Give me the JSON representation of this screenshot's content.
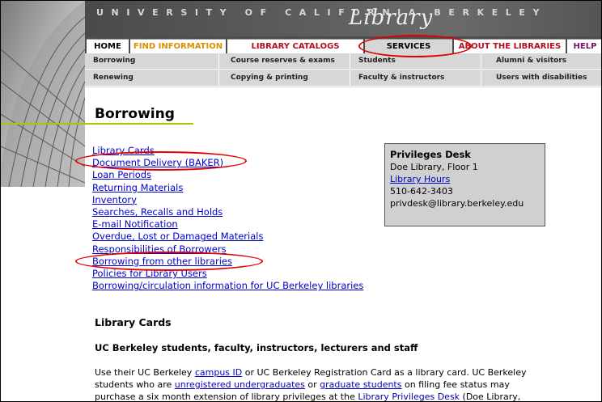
{
  "banner": {
    "university": "UNIVERSITY OF CALIFORNIA BERKELEY",
    "library": "Library"
  },
  "tabs": [
    {
      "label": "HOME",
      "name": "tab-home"
    },
    {
      "label": "FIND INFORMATION",
      "name": "tab-find-information"
    },
    {
      "label": "LIBRARY CATALOGS",
      "name": "tab-library-catalogs"
    },
    {
      "label": "SERVICES",
      "name": "tab-services"
    },
    {
      "label": "ABOUT THE LIBRARIES",
      "name": "tab-about-the-libraries"
    },
    {
      "label": "HELP",
      "name": "tab-help"
    }
  ],
  "subnav": {
    "row1": [
      "Borrowing",
      "Course reserves & exams",
      "Students",
      "Alumni & visitors"
    ],
    "row2": [
      "Renewing",
      "Copying & printing",
      "Faculty & instructors",
      "Users with disabilities"
    ]
  },
  "page": {
    "title": "Borrowing"
  },
  "links": [
    "Library Cards",
    "Document Delivery (BAKER)",
    "Loan Periods",
    "Returning Materials",
    "Inventory",
    "Searches, Recalls and Holds",
    "E-mail Notification",
    "Overdue, Lost or Damaged Materials",
    "Responsibilities of Borrowers",
    "Borrowing from other libraries",
    "Policies for Library Users",
    "Borrowing/circulation information for UC Berkeley libraries"
  ],
  "desk": {
    "title": "Privileges Desk",
    "location": "Doe Library, Floor 1",
    "hours_link": "Library Hours",
    "phone": "510-642-3403",
    "email": "privdesk@library.berkeley.edu"
  },
  "section": {
    "heading": "Library Cards",
    "subheading": "UC Berkeley students, faculty, instructors, lecturers and staff",
    "p1": "Use their UC Berkeley ",
    "link_campus_id": "campus ID",
    "p2": " or UC Berkeley Registration Card as a library card. UC Berkeley",
    "p3": "students who are ",
    "link_unregistered": "unregistered undergraduates",
    "p4": " or ",
    "link_graduate": "graduate students",
    "p5": " on filing fee status may",
    "p6": "purchase a six month extension of library privileges at the ",
    "link_privdesk": "Library Privileges Desk",
    "p7": " (Doe Library,"
  },
  "colors": {
    "annotation": "#e00000",
    "link": "#0000cc",
    "title_underline": "#a8c800"
  }
}
